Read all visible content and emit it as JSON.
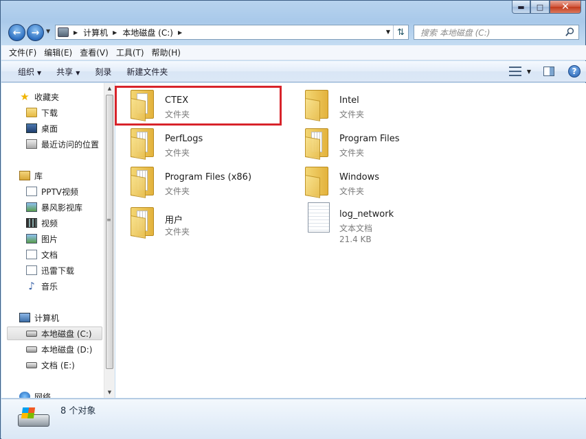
{
  "window": {
    "caption_buttons": {
      "minimize": "▬",
      "maximize": "□",
      "close": "✕"
    }
  },
  "nav": {
    "back_glyph": "←",
    "forward_glyph": "→",
    "breadcrumbs": [
      "计算机",
      "本地磁盘 (C:)"
    ],
    "refresh_glyph": "⇅",
    "search_placeholder": "搜索 本地磁盘 (C:)"
  },
  "menu": [
    "文件(F)",
    "编辑(E)",
    "查看(V)",
    "工具(T)",
    "帮助(H)"
  ],
  "toolbar": {
    "organize": "组织",
    "share": "共享",
    "burn": "刻录",
    "new_folder": "新建文件夹",
    "help": "?"
  },
  "sidebar": {
    "favorites": {
      "label": "收藏夹",
      "items": [
        "下载",
        "桌面",
        "最近访问的位置"
      ]
    },
    "libraries": {
      "label": "库",
      "items": [
        "PPTV视频",
        "暴风影视库",
        "视频",
        "图片",
        "文档",
        "迅雷下载",
        "音乐"
      ]
    },
    "computer": {
      "label": "计算机",
      "items": [
        "本地磁盘 (C:)",
        "本地磁盘 (D:)",
        "文档 (E:)"
      ]
    },
    "network": {
      "label": "网络"
    }
  },
  "files": [
    {
      "name": "CTEX",
      "type": "文件夹",
      "icon": "folder-icon",
      "highlighted": true
    },
    {
      "name": "Intel",
      "type": "文件夹",
      "icon": "folder-icon"
    },
    {
      "name": "PerfLogs",
      "type": "文件夹",
      "icon": "folder-icon"
    },
    {
      "name": "Program Files",
      "type": "文件夹",
      "icon": "folder-icon"
    },
    {
      "name": "Program Files (x86)",
      "type": "文件夹",
      "icon": "folder-icon"
    },
    {
      "name": "Windows",
      "type": "文件夹",
      "icon": "folder-icon"
    },
    {
      "name": "用户",
      "type": "文件夹",
      "icon": "folder-icon"
    },
    {
      "name": "log_network",
      "type": "文本文档",
      "size": "21.4 KB",
      "icon": "text-document-icon"
    }
  ],
  "status": {
    "count": "8 个对象"
  },
  "colors": {
    "highlight_border": "#d8232a",
    "window_frame": "#a9c9ea"
  }
}
